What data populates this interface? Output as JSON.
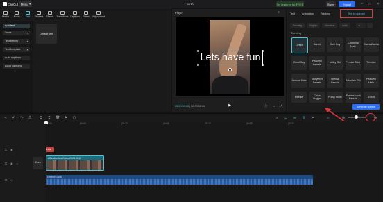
{
  "app": {
    "name": "CapCut",
    "menu_label": "Menu",
    "project_title": "0710"
  },
  "top_actions": {
    "pro_label": "Try features for FREE",
    "share_label": "Share",
    "export_label": "Export"
  },
  "media_tabs": [
    {
      "label": "Media"
    },
    {
      "label": "Audio"
    },
    {
      "label": "Text",
      "active": true
    },
    {
      "label": "Stickers"
    },
    {
      "label": "Effects"
    },
    {
      "label": "Transitions"
    },
    {
      "label": "Captions"
    },
    {
      "label": "Filters"
    },
    {
      "label": "Adjustment"
    }
  ],
  "left_sidebar": {
    "items": [
      "Add text",
      "Yours",
      "Text effects",
      "Text template",
      "Auto captions",
      "Local captions"
    ]
  },
  "text_panel": {
    "default_text": "Default text"
  },
  "player": {
    "title": "Player",
    "overlay_text": "Lets have fun",
    "current_time": "00:00:00:00",
    "total_time": "00:00:02:00"
  },
  "right_panel": {
    "tabs": [
      "Text",
      "Animation",
      "Tracking",
      "Text to speech"
    ],
    "active_tab": "Text to speech",
    "language_chips": [
      "Trending",
      "English",
      "Narration",
      "Indie"
    ],
    "section_label": "Trending",
    "voices": [
      "Jessie",
      "Daniel",
      "Cute Boy",
      "Charming Male",
      "Suara Wanita",
      "Good Guy",
      "Peaceful Female",
      "Valley Girl",
      "Female Tutor",
      "Trickster",
      "Serious Male",
      "Storyteller Female",
      "Normal Female",
      "Adorable Girl",
      "Peaceful Male",
      "Michael",
      "Chica Vlogger",
      "Pussy mode",
      "Professio nal Female",
      "ASMR"
    ],
    "selected_voice": "Jessie",
    "generate_label": "Generate speech"
  },
  "timeline": {
    "ruler_ticks": [
      "00:00",
      "|00:05",
      "|00:10",
      "|00:15",
      "|00:20",
      "|00:25",
      "|00:30"
    ],
    "text_clip_label": "Lets",
    "video_clip_label": "AIFinalizeNew0Video 00:00:00:00",
    "cover_label": "Cover",
    "audio_clip_label": "Lyrebird Cloud"
  },
  "colors": {
    "accent": "#4ec3d8",
    "highlight": "#e3373b",
    "primary_button": "#2d6ef5"
  }
}
